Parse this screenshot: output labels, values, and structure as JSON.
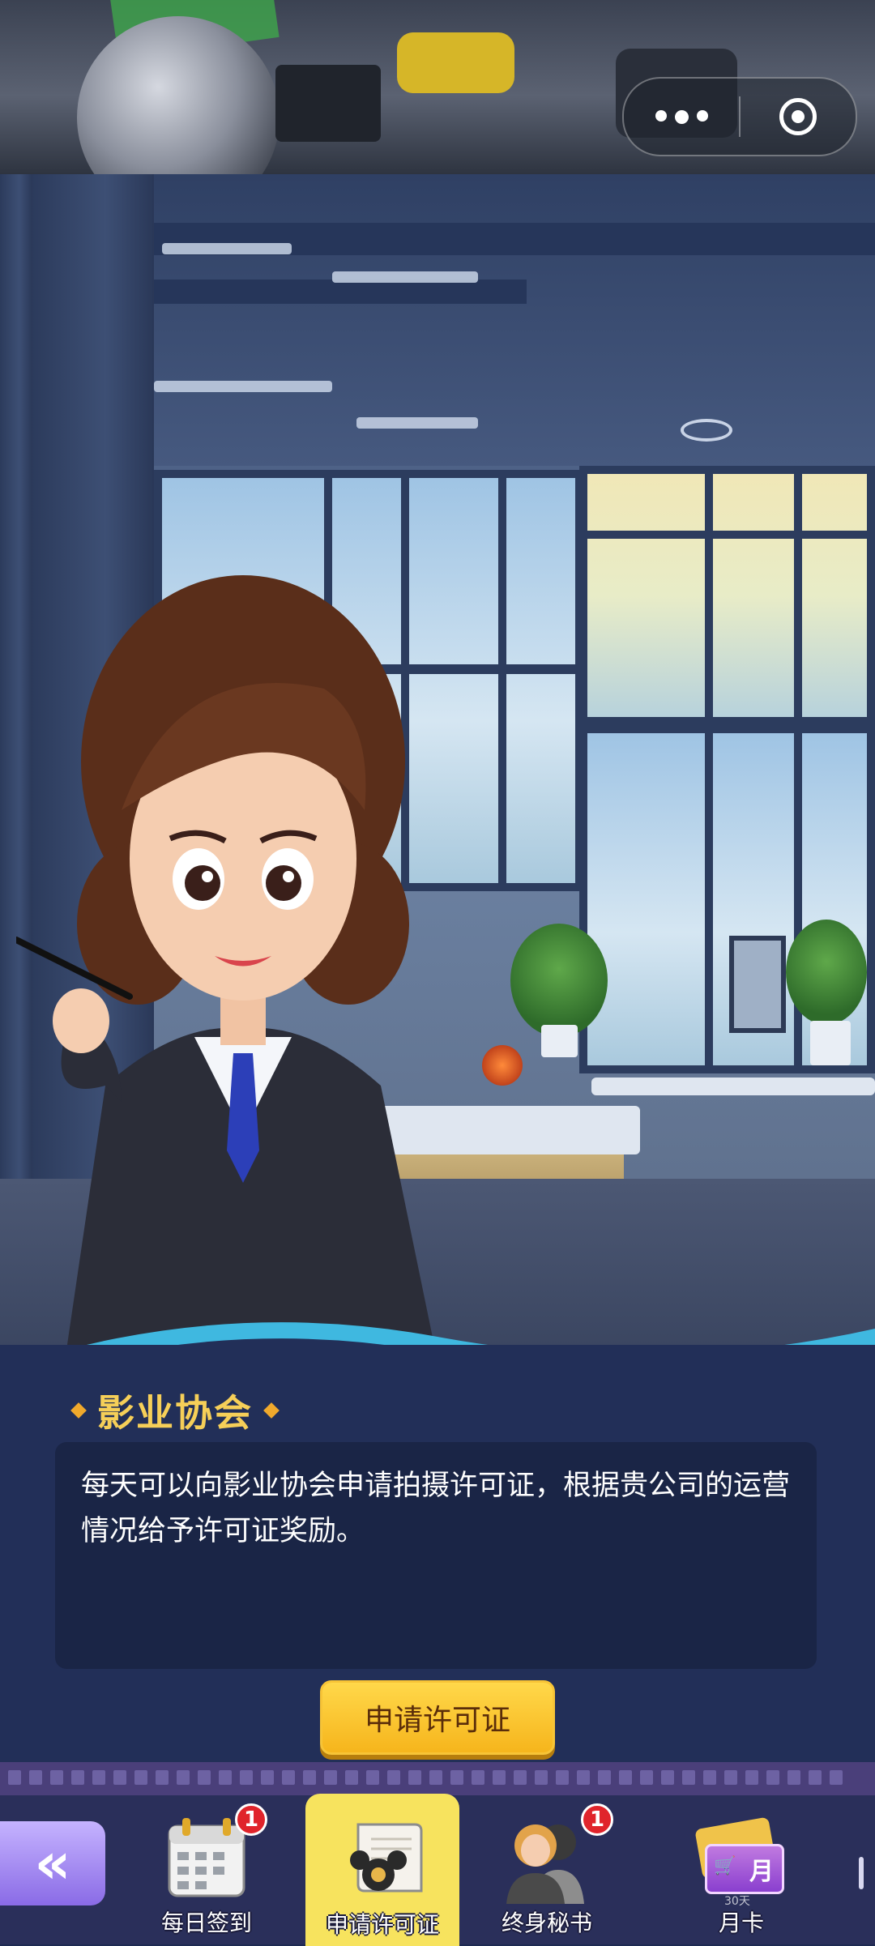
{
  "capsule": {
    "more_icon": "more-dots-icon",
    "close_icon": "target-close-icon"
  },
  "panel": {
    "title": "影业协会",
    "description": "每天可以向影业协会申请拍摄许可证，根据贵公司的运营情况给予许可证奖励。",
    "apply_button": "申请许可证"
  },
  "nav": {
    "back_label": "«",
    "items": [
      {
        "label": "每日签到",
        "icon": "calendar-icon",
        "badge": "1",
        "active": false
      },
      {
        "label": "申请许可证",
        "icon": "license-scroll-icon",
        "badge": "",
        "active": true
      },
      {
        "label": "终身秘书",
        "icon": "secretary-icon",
        "badge": "1",
        "active": false
      },
      {
        "label": "月卡",
        "icon": "month-card-icon",
        "badge": "",
        "active": false
      }
    ],
    "card_text": "月",
    "card_subtext": "30天"
  },
  "colors": {
    "title_gold": "#f6cf58",
    "button_yellow": "#f6b51c",
    "panel_navy": "#222f58",
    "badge_red": "#e0242b"
  }
}
